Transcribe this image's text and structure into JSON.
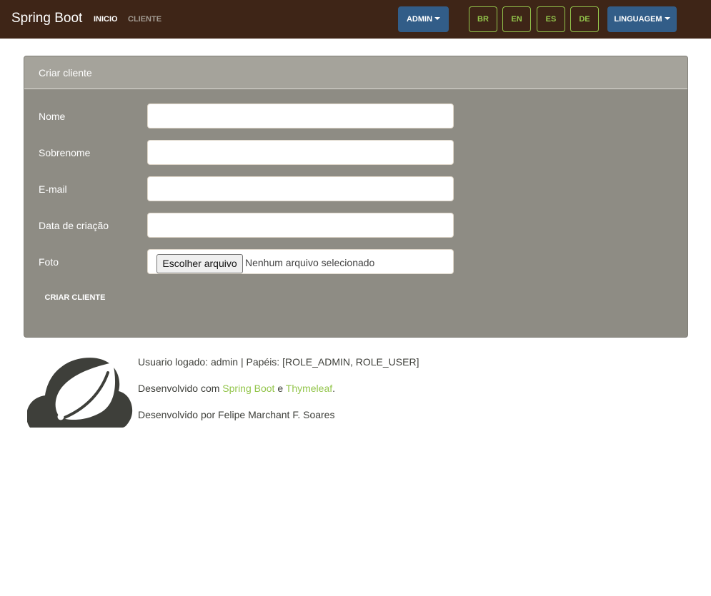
{
  "navbar": {
    "brand": "Spring Boot",
    "links": [
      {
        "label": "INICIO",
        "active": true
      },
      {
        "label": "CLIENTE",
        "active": false
      }
    ],
    "admin_dropdown": "ADMIN",
    "lang_buttons": [
      "BR",
      "EN",
      "ES",
      "DE"
    ],
    "lang_dropdown": "LINGUAGEM"
  },
  "form": {
    "title": "Criar cliente",
    "fields": [
      {
        "label": "Nome",
        "value": ""
      },
      {
        "label": "Sobrenome",
        "value": ""
      },
      {
        "label": "E-mail",
        "value": ""
      },
      {
        "label": "Data de criação",
        "value": ""
      },
      {
        "label": "Foto"
      }
    ],
    "file_button": "Escolher arquivo",
    "file_status": "Nenhum arquivo selecionado",
    "submit_label": "CRIAR CLIENTE"
  },
  "footer": {
    "user_line": "Usuario logado: admin | Papéis: [ROLE_ADMIN, ROLE_USER]",
    "dev_prefix": "Desenvolvido com ",
    "link1": "Spring Boot",
    "dev_mid": " e ",
    "link2": "Thymeleaf",
    "dev_suffix": ".",
    "author_line": "Desenvolvido por Felipe Marchant F. Soares"
  },
  "colors": {
    "navbar_bg": "#3e2517",
    "accent_green": "#93c54b",
    "button_blue": "#325d88",
    "card_bg": "#8e8c84",
    "card_header_bg": "#a5a39b"
  },
  "icons": {
    "logo": "spring-leaf-cloud-logo",
    "dropdown": "caret-down-icon"
  }
}
